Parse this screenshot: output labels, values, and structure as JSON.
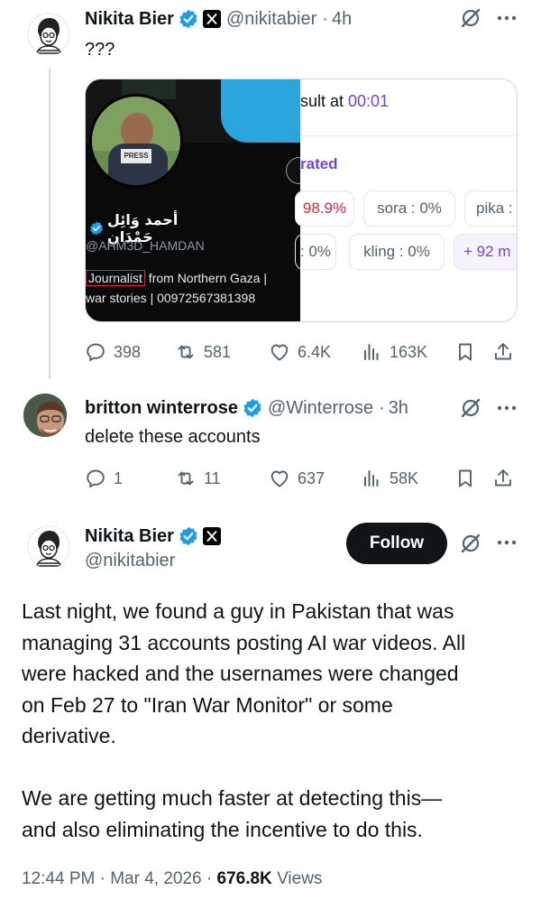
{
  "tweet1": {
    "display_name": "Nikita Bier",
    "handle": "@nikitabier",
    "time": "4h",
    "text": "???",
    "media": {
      "profile_name": "أحمد وَائِل حَمْدَان",
      "profile_handle": "@AHM3D_HAMDAN",
      "bio_line1_highlight": "Journalist",
      "bio_line1_rest": " from Northern Gaza | ",
      "bio_line2": "war stories | 00972567381398 ",
      "press_label": "PRESS",
      "panel_title_prefix": "sult at ",
      "panel_title_time": "00:01",
      "panel_subtitle": "rated",
      "row1": [
        "98.9%",
        "sora : 0%",
        "pika :"
      ],
      "row2": [
        ": 0%",
        "kling : 0%",
        "+ 92 m"
      ]
    },
    "stats": {
      "replies": "398",
      "reposts": "581",
      "likes": "6.4K",
      "views": "163K"
    }
  },
  "tweet2": {
    "display_name": "britton winterrose",
    "handle": "@Winterrose",
    "time": "3h",
    "text": "delete these accounts",
    "stats": {
      "replies": "1",
      "reposts": "11",
      "likes": "637",
      "views": "58K"
    }
  },
  "tweet3": {
    "display_name": "Nikita Bier",
    "handle": "@nikitabier",
    "follow_label": "Follow",
    "text_lines": [
      "Last night, we found a guy in Pakistan that was",
      "managing 31 accounts posting AI war videos. All",
      "were hacked and the usernames were changed",
      "on Feb 27 to \"Iran War Monitor\" or some",
      "derivative.",
      "",
      "We are getting much faster at detecting this—",
      "and also eliminating the incentive to do this."
    ],
    "time": "12:44 PM",
    "date": "Mar 4, 2026",
    "views_count": "676.8K",
    "views_label": "Views"
  },
  "colors": {
    "accent": "#1d9bf0",
    "muted": "#536471",
    "purple": "#6d45e6",
    "red": "#e0243b"
  },
  "icons": [
    "grok-icon",
    "more-icon",
    "reply-icon",
    "repost-icon",
    "like-icon",
    "views-icon",
    "bookmark-icon",
    "share-icon",
    "verified-icon",
    "x-affiliate-icon"
  ]
}
